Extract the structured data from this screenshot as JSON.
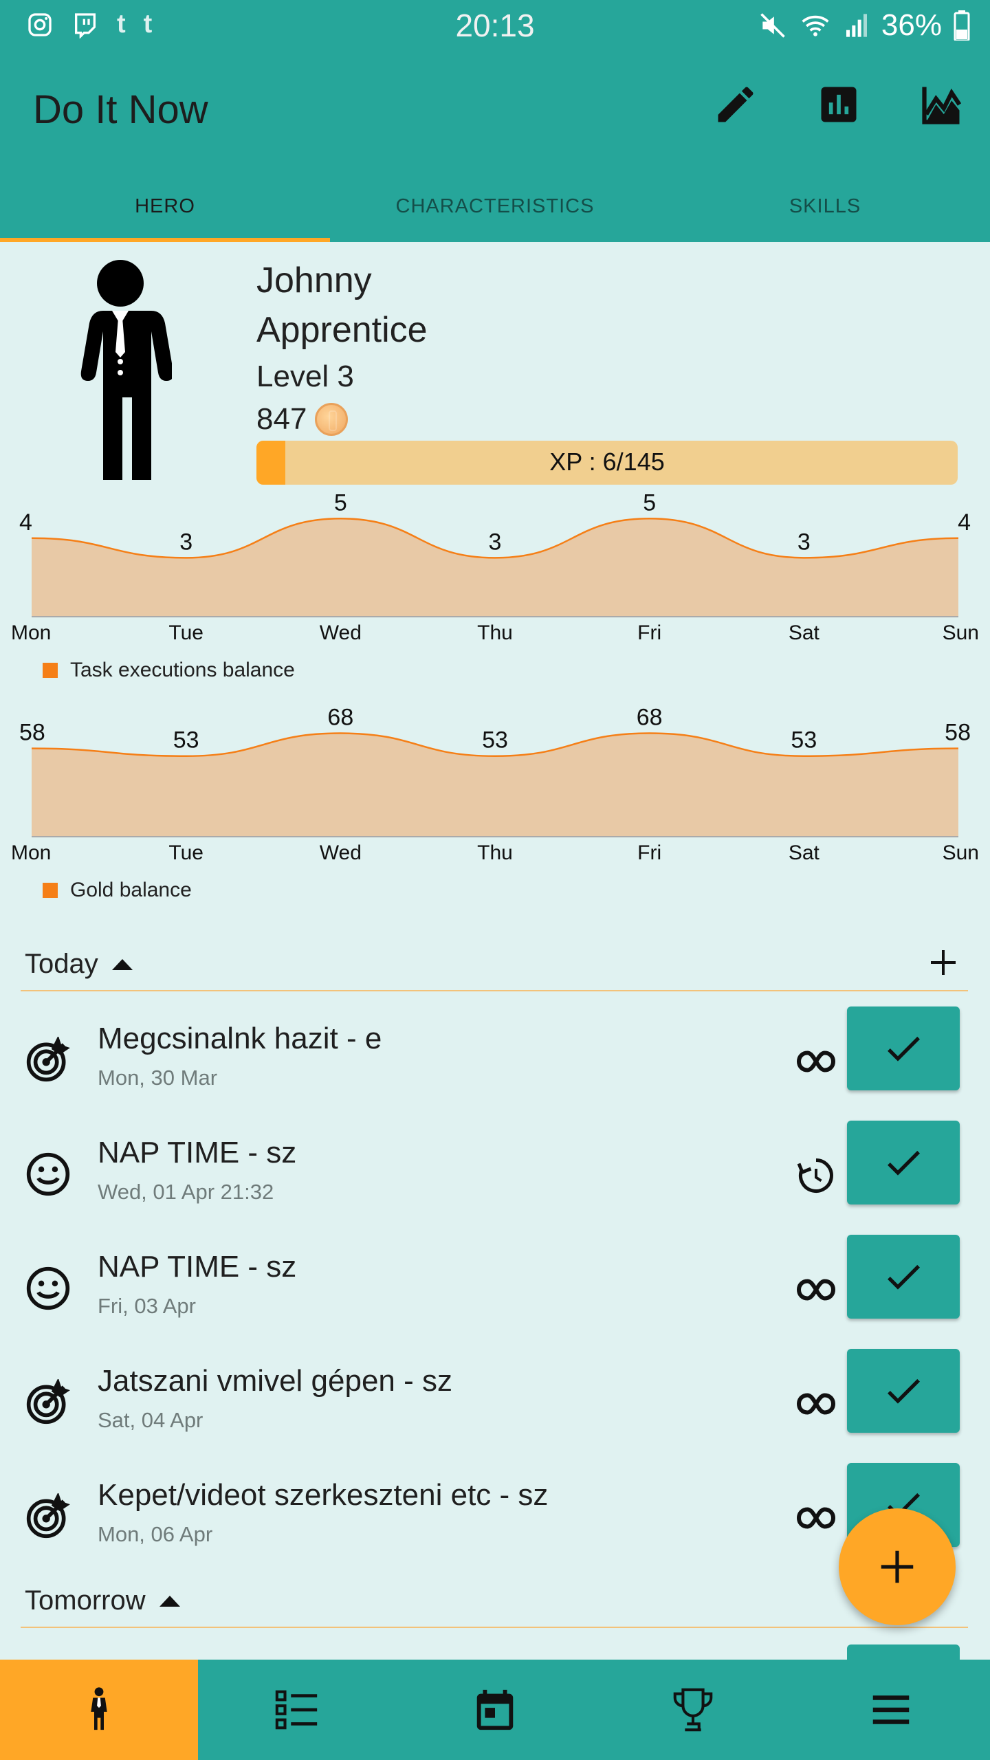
{
  "status_bar": {
    "time": "20:13",
    "battery": "36%",
    "notification_icons": [
      "instagram-icon",
      "twitch-icon",
      "tumblr-icon",
      "tumblr-icon"
    ],
    "status_icons": [
      "mute-icon",
      "wifi-icon",
      "signal-icon",
      "battery-icon"
    ]
  },
  "app_bar": {
    "title": "Do It Now",
    "actions": [
      "edit-icon",
      "bar-chart-icon",
      "line-chart-icon"
    ]
  },
  "tabs": [
    {
      "label": "HERO",
      "active": true
    },
    {
      "label": "CHARACTERISTICS",
      "active": false
    },
    {
      "label": "SKILLS",
      "active": false
    }
  ],
  "hero": {
    "name": "Johnny",
    "rank": "Apprentice",
    "level": "Level 3",
    "gold": "847",
    "xp_label": "XP : 6/145",
    "xp_fraction": 0.041
  },
  "chart_data": [
    {
      "type": "area",
      "categories": [
        "Mon",
        "Tue",
        "Wed",
        "Thu",
        "Fri",
        "Sat",
        "Sun"
      ],
      "series": [
        {
          "name": "Task executions balance",
          "values": [
            4,
            3,
            5,
            3,
            5,
            3,
            4
          ]
        }
      ],
      "ylim": [
        0,
        6.2
      ],
      "legend": "bottom-left",
      "colors": {
        "line": "#F57F17",
        "fill": "#E8C9A6"
      }
    },
    {
      "type": "area",
      "categories": [
        "Mon",
        "Tue",
        "Wed",
        "Thu",
        "Fri",
        "Sat",
        "Sun"
      ],
      "series": [
        {
          "name": "Gold balance",
          "values": [
            58,
            53,
            68,
            53,
            68,
            53,
            58
          ]
        }
      ],
      "ylim": [
        0,
        80
      ],
      "legend": "bottom-left",
      "colors": {
        "line": "#F57F17",
        "fill": "#E8C9A6"
      }
    }
  ],
  "sections": {
    "today": {
      "label": "Today",
      "tasks": [
        {
          "name": "Megcsinalnk hazit - e",
          "date": "Mon, 30 Mar",
          "icon": "target-icon",
          "repeat": "infinity-icon"
        },
        {
          "name": "NAP TIME - sz",
          "date": "Wed, 01 Apr 21:32",
          "icon": "smiley-icon",
          "repeat": "history-icon"
        },
        {
          "name": "NAP TIME - sz",
          "date": "Fri, 03 Apr",
          "icon": "smiley-icon",
          "repeat": "infinity-icon"
        },
        {
          "name": "Jatszani vmivel gépen - sz",
          "date": "Sat, 04 Apr",
          "icon": "target-icon",
          "repeat": "infinity-icon"
        },
        {
          "name": "Kepet/videot szerkeszteni etc - sz",
          "date": "Mon, 06 Apr",
          "icon": "target-icon",
          "repeat": "infinity-icon"
        }
      ]
    },
    "tomorrow": {
      "label": "Tomorrow"
    }
  },
  "bottom_nav": [
    "hero-icon",
    "task-list-icon",
    "calendar-icon",
    "trophy-icon",
    "menu-icon"
  ],
  "colors": {
    "primary": "#26A69A",
    "accent": "#FFA726",
    "background": "#E0F2F1"
  }
}
